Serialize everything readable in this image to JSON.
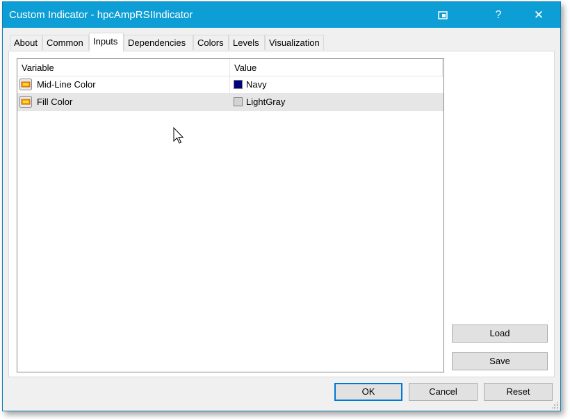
{
  "window": {
    "title": "Custom Indicator - hpcAmpRSIIndicator",
    "help_symbol": "?",
    "close_symbol": "✕"
  },
  "tabs": [
    {
      "label": "About"
    },
    {
      "label": "Common"
    },
    {
      "label": "Inputs",
      "active": true
    },
    {
      "label": "Dependencies"
    },
    {
      "label": "Colors"
    },
    {
      "label": "Levels"
    },
    {
      "label": "Visualization"
    }
  ],
  "grid": {
    "columns": [
      "Variable",
      "Value"
    ],
    "rows": [
      {
        "variable": "Mid-Line Color",
        "value": "Navy",
        "color": "#000080",
        "selected": false
      },
      {
        "variable": "Fill Color",
        "value": "LightGray",
        "color": "#d3d3d3",
        "selected": true
      }
    ]
  },
  "side_buttons": {
    "load": "Load",
    "save": "Save"
  },
  "footer_buttons": {
    "ok": "OK",
    "cancel": "Cancel",
    "reset": "Reset"
  }
}
